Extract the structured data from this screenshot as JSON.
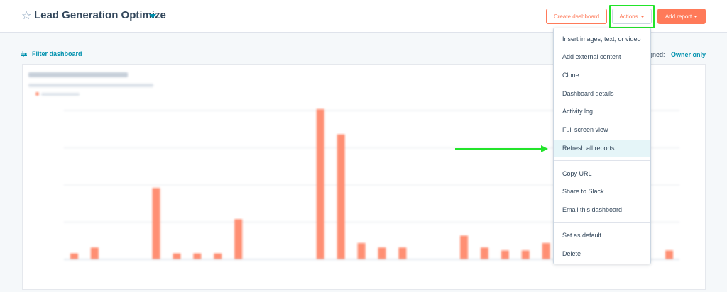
{
  "header": {
    "title": "Lead Generation Optimize",
    "create_dashboard_label": "Create dashboard",
    "actions_label": "Actions",
    "add_report_label": "Add report"
  },
  "filter": {
    "label": "Filter dashboard",
    "assigned_label": "gned:",
    "owner_label": "Owner only"
  },
  "actions_menu": {
    "items": [
      "Insert images, text, or video",
      "Add external content",
      "Clone",
      "Dashboard details",
      "Activity log",
      "Full screen view",
      "Refresh all reports",
      "Copy URL",
      "Share to Slack",
      "Email this dashboard",
      "Set as default",
      "Delete"
    ],
    "highlighted_item": "Refresh all reports"
  },
  "colors": {
    "accent": "#ff7a59",
    "link": "#0091ae",
    "highlight_box": "#22e42a",
    "bar": "#ff8f73"
  },
  "chart_data": {
    "type": "bar",
    "values": [
      40,
      80,
      0,
      0,
      480,
      40,
      40,
      40,
      270,
      0,
      0,
      0,
      1010,
      840,
      110,
      80,
      80,
      0,
      0,
      160,
      80,
      60,
      60,
      110,
      50,
      0,
      0,
      0,
      0,
      60
    ],
    "ylim": [
      0,
      1000
    ],
    "grid": true
  }
}
